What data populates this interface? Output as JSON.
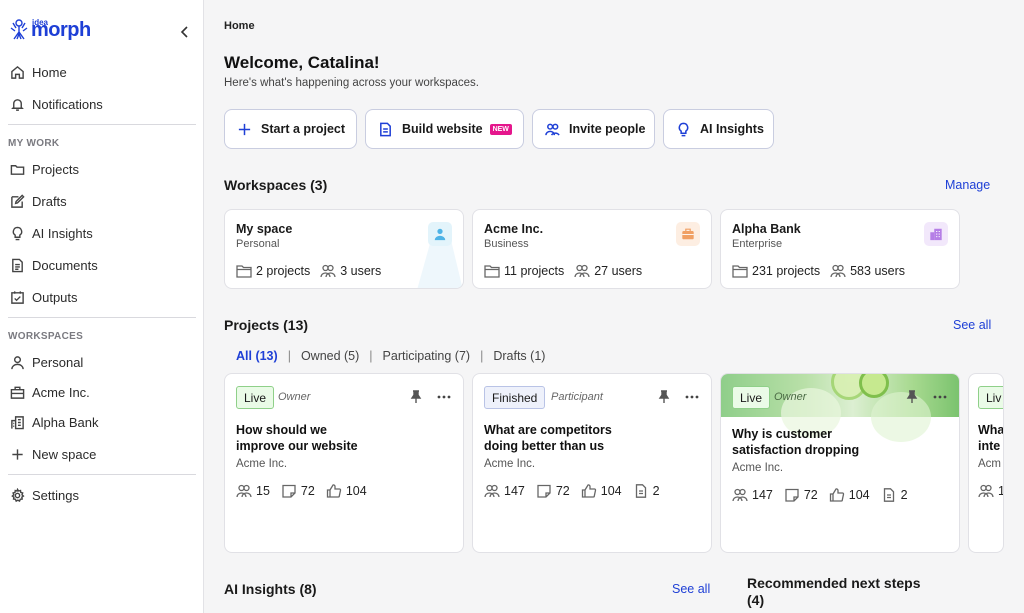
{
  "brand": {
    "small": "idea",
    "name": "morph"
  },
  "sidebar": {
    "top": [
      {
        "label": "Home",
        "icon": "home-icon"
      },
      {
        "label": "Notifications",
        "icon": "bell-icon"
      }
    ],
    "my_work_label": "MY WORK",
    "my_work": [
      {
        "label": "Projects",
        "icon": "folder-icon"
      },
      {
        "label": "Drafts",
        "icon": "edit-icon"
      },
      {
        "label": "AI Insights",
        "icon": "lightbulb-icon"
      },
      {
        "label": "Documents",
        "icon": "document-icon"
      },
      {
        "label": "Outputs",
        "icon": "checkbox-icon"
      }
    ],
    "workspaces_label": "WORKSPACES",
    "workspaces": [
      {
        "label": "Personal",
        "icon": "user-icon"
      },
      {
        "label": "Acme Inc.",
        "icon": "briefcase-icon"
      },
      {
        "label": "Alpha Bank",
        "icon": "building-icon"
      }
    ],
    "new_space": "New space",
    "settings": "Settings"
  },
  "main": {
    "breadcrumb": "Home",
    "welcome": "Welcome, Catalina!",
    "subtitle": "Here's what's happening across your workspaces.",
    "quick_actions": [
      {
        "label": "Start a project",
        "icon": "plus-icon"
      },
      {
        "label": "Build website",
        "icon": "page-icon",
        "badge": "NEW"
      },
      {
        "label": "Invite people",
        "icon": "people-icon"
      },
      {
        "label": "AI Insights",
        "icon": "lightbulb-icon"
      }
    ],
    "workspaces_title": "Workspaces (3)",
    "manage": "Manage",
    "workspaces": [
      {
        "name": "My space",
        "type": "Personal",
        "projects": "2 projects",
        "users": "3 users",
        "badge_color": "#e3f4fb"
      },
      {
        "name": "Acme Inc.",
        "type": "Business",
        "projects": "11 projects",
        "users": "27 users",
        "badge_color": "#fdeee2"
      },
      {
        "name": "Alpha Bank",
        "type": "Enterprise",
        "projects": "231 projects",
        "users": "583 users",
        "badge_color": "#f2e8fb"
      }
    ],
    "projects_title": "Projects (13)",
    "see_all": "See all",
    "tabs": [
      "All (13)",
      "Owned (5)",
      "Participating (7)",
      "Drafts (1)"
    ],
    "projects": [
      {
        "status": "Live",
        "role": "Owner",
        "title_line1": "How should we",
        "title_line2": "improve our website",
        "company": "Acme Inc.",
        "members": "15",
        "comments": "72",
        "likes": "104",
        "docs": ""
      },
      {
        "status": "Finished",
        "role": "Participant",
        "title_line1": "What are competitors",
        "title_line2": "doing better than us",
        "company": "Acme Inc.",
        "members": "147",
        "comments": "72",
        "likes": "104",
        "docs": "2"
      },
      {
        "status": "Live",
        "role": "Owner",
        "title_line1": "Why is customer",
        "title_line2": "satisfaction dropping",
        "company": "Acme Inc.",
        "members": "147",
        "comments": "72",
        "likes": "104",
        "docs": "2"
      },
      {
        "status": "Liv",
        "role": "",
        "title_line1": "Wha",
        "title_line2": "inte",
        "company": "Acm",
        "members": "1",
        "comments": "",
        "likes": "",
        "docs": ""
      }
    ],
    "ai_insights_title": "AI Insights (8)",
    "ai_see_all": "See all",
    "recommended_line1": "Recommended next steps",
    "recommended_line2": "(4)"
  }
}
